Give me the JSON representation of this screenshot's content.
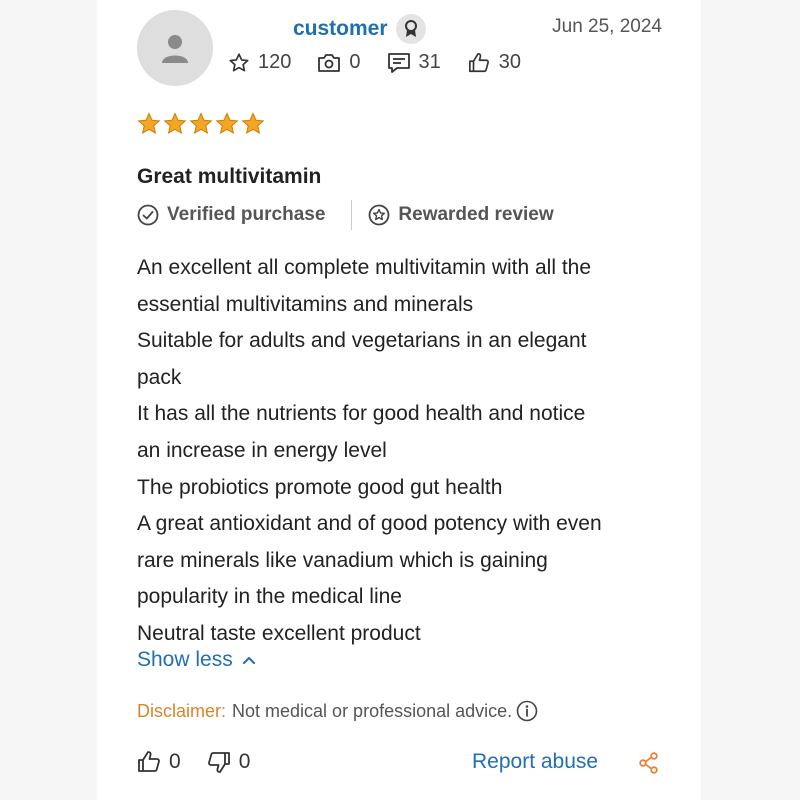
{
  "review": {
    "username": "customer",
    "date": "Jun 25, 2024",
    "stats": {
      "points": "120",
      "photos": "0",
      "comments": "31",
      "likes": "30"
    },
    "rating": 5,
    "rating_max": 5,
    "title": "Great multivitamin",
    "verified_label": "Verified purchase",
    "rewarded_label": "Rewarded review",
    "body_lines": [
      "An excellent all complete multivitamin with all the",
      "essential multivitamins and minerals",
      "Suitable for adults and vegetarians in an elegant",
      "pack",
      "It has all the nutrients for good health and notice",
      "an increase in energy level",
      "The probiotics promote good gut health",
      "A great antioxidant and of good potency with even",
      "rare minerals like vanadium which is gaining",
      "popularity in the medical line",
      "Neutral taste excellent product"
    ],
    "show_less_label": "Show less",
    "disclaimer_label": "Disclaimer:",
    "disclaimer_text": "Not medical or professional advice.",
    "helpful_count": "0",
    "unhelpful_count": "0",
    "report_label": "Report abuse"
  },
  "colors": {
    "link": "#1f6fb2",
    "star": "#f5a623",
    "disclaimer": "#d9832a"
  },
  "icons": {
    "avatar": "user-silhouette-icon",
    "badge": "award-badge-icon",
    "points": "star-outline-icon",
    "photos": "camera-icon",
    "comments": "comment-icon",
    "likes": "thumbs-up-icon",
    "verified": "check-circle-icon",
    "rewarded": "star-circle-icon",
    "chevron": "chevron-up-icon",
    "info": "info-icon",
    "helpful": "thumbs-up-icon",
    "unhelpful": "thumbs-down-icon",
    "share": "share-icon"
  }
}
